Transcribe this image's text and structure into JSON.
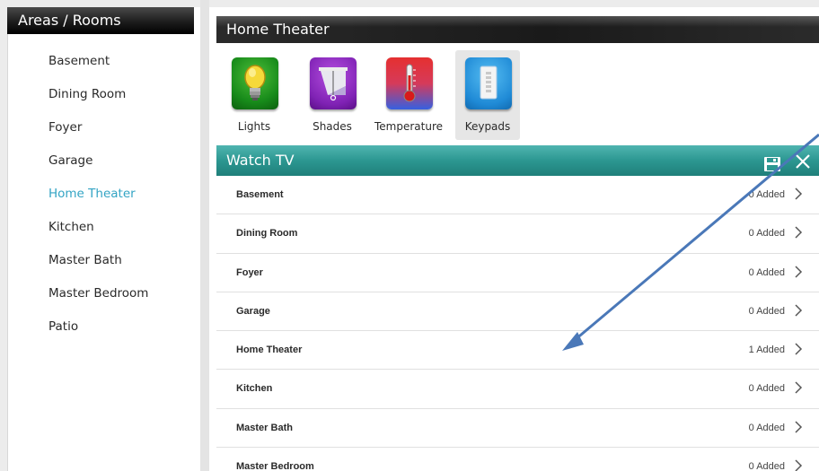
{
  "sidebar": {
    "title": "Areas / Rooms",
    "items": [
      {
        "label": "Basement",
        "active": false
      },
      {
        "label": "Dining Room",
        "active": false
      },
      {
        "label": "Foyer",
        "active": false
      },
      {
        "label": "Garage",
        "active": false
      },
      {
        "label": "Home Theater",
        "active": true
      },
      {
        "label": "Kitchen",
        "active": false
      },
      {
        "label": "Master Bath",
        "active": false
      },
      {
        "label": "Master Bedroom",
        "active": false
      },
      {
        "label": "Patio",
        "active": false
      }
    ]
  },
  "main": {
    "title": "Home Theater",
    "categories": [
      {
        "label": "Lights",
        "icon": "lightbulb-icon"
      },
      {
        "label": "Shades",
        "icon": "shades-icon"
      },
      {
        "label": "Temperature",
        "icon": "thermometer-icon"
      },
      {
        "label": "Keypads",
        "icon": "keypad-icon",
        "selected": true
      }
    ],
    "scene": {
      "title": "Watch TV",
      "save_icon": "save-icon",
      "close_icon": "close-icon"
    },
    "rows": [
      {
        "name": "Basement",
        "count": "0 Added"
      },
      {
        "name": "Dining Room",
        "count": "0 Added"
      },
      {
        "name": "Foyer",
        "count": "0 Added"
      },
      {
        "name": "Garage",
        "count": "0 Added"
      },
      {
        "name": "Home Theater",
        "count": "1 Added"
      },
      {
        "name": "Kitchen",
        "count": "0 Added"
      },
      {
        "name": "Master Bath",
        "count": "0 Added"
      },
      {
        "name": "Master Bedroom",
        "count": "0 Added"
      }
    ]
  },
  "colors": {
    "accent": "#33a4c4",
    "scene_bar": "#2c9791",
    "annotation_arrow": "#4a78b8"
  }
}
